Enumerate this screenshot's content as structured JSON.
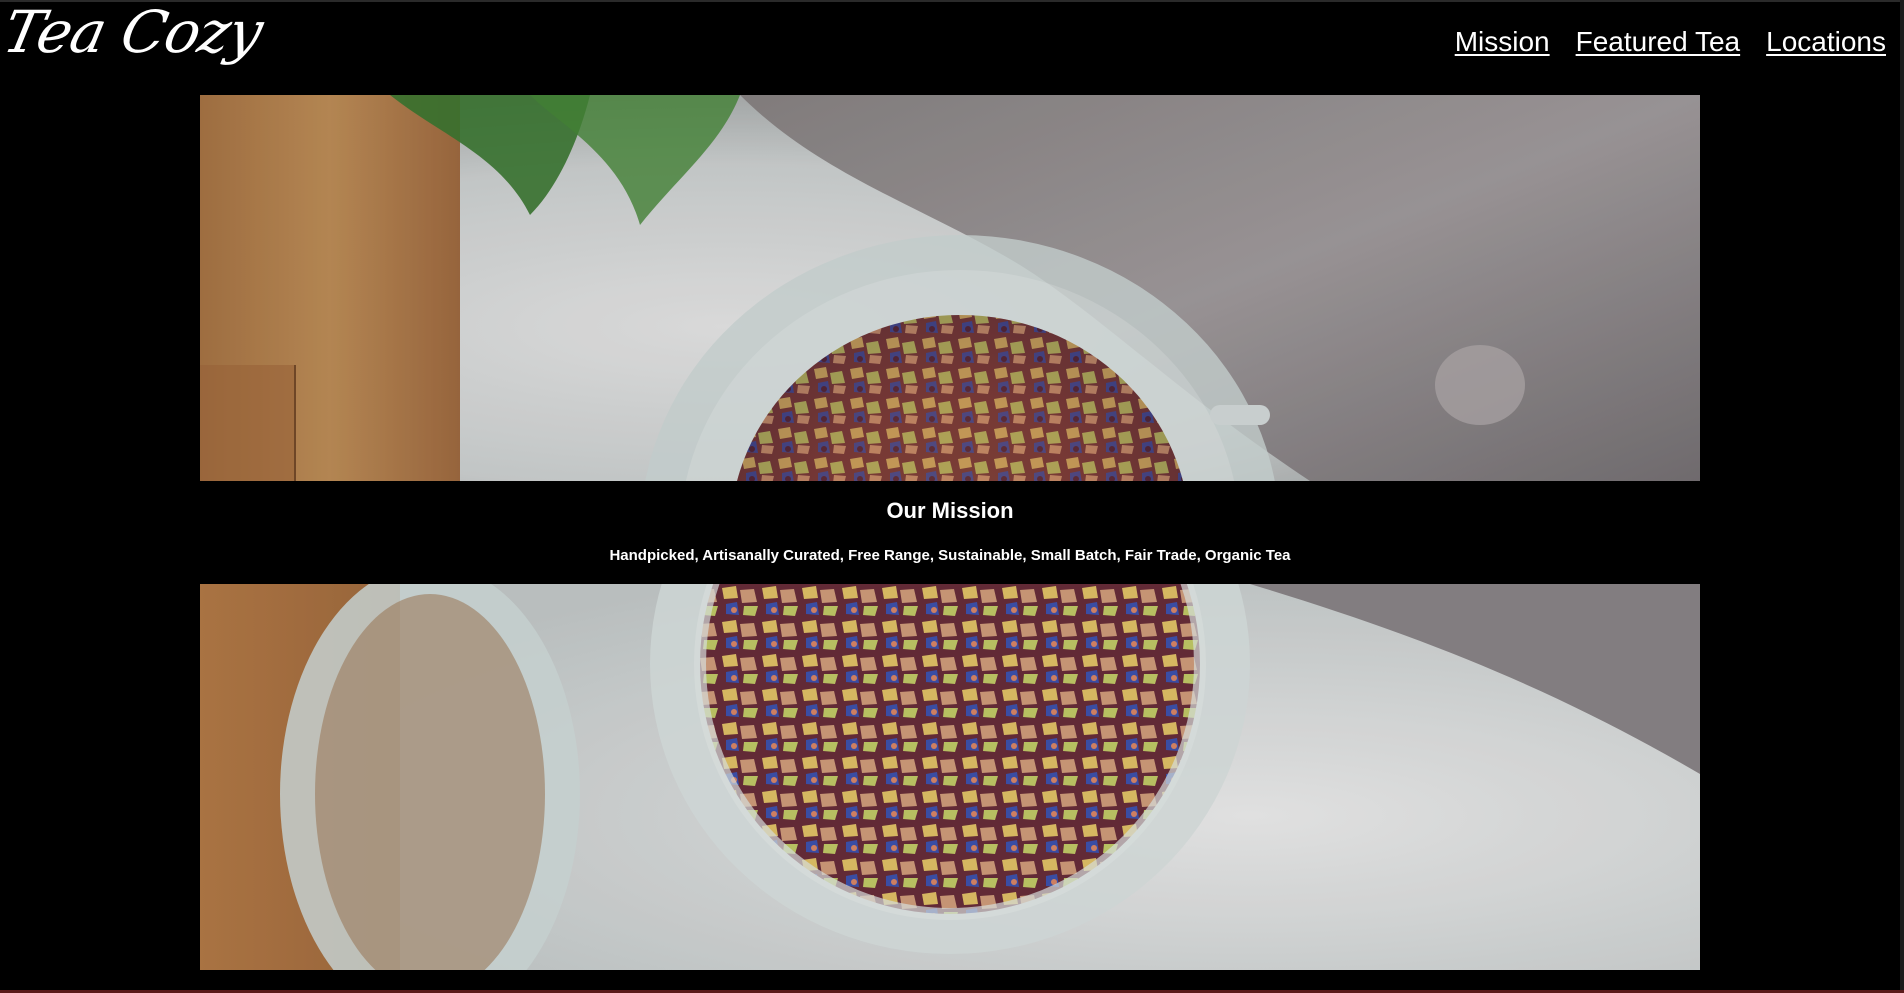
{
  "header": {
    "logo_text": "Tea Cozy",
    "nav": [
      {
        "label": "Mission"
      },
      {
        "label": "Featured Tea"
      },
      {
        "label": "Locations"
      }
    ]
  },
  "hero": {
    "image_subject": "jar of loose-leaf flower tea on wooden table"
  },
  "mission": {
    "title": "Our Mission",
    "tagline": "Handpicked, Artisanally Curated, Free Range, Sustainable, Small Batch, Fair Trade, Organic Tea"
  },
  "colors": {
    "background": "#000000",
    "text": "#ffffff"
  }
}
